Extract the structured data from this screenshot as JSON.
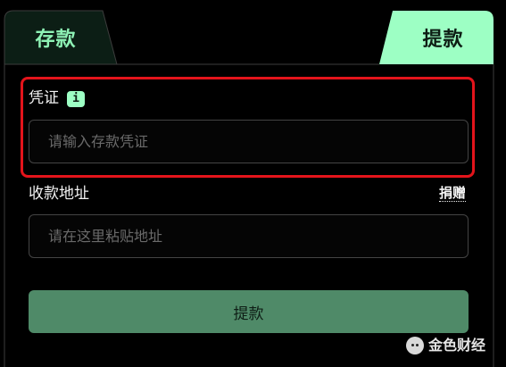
{
  "tabs": [
    {
      "label": "存款",
      "active": false
    },
    {
      "label": "提款",
      "active": true
    }
  ],
  "form": {
    "voucher": {
      "label": "凭证",
      "info_badge": "i",
      "placeholder": "请输入存款凭证",
      "value": ""
    },
    "address": {
      "label": "收款地址",
      "donate_link": "捐赠",
      "placeholder": "请在这里粘贴地址",
      "value": ""
    },
    "submit_label": "提款"
  },
  "watermark": {
    "text": "金色财经"
  },
  "colors": {
    "background": "#000000",
    "accent": "#9dffc4",
    "inactive_tab_text": "#8ef2b5",
    "button": "#4f8a68",
    "highlight": "#e3141b"
  }
}
